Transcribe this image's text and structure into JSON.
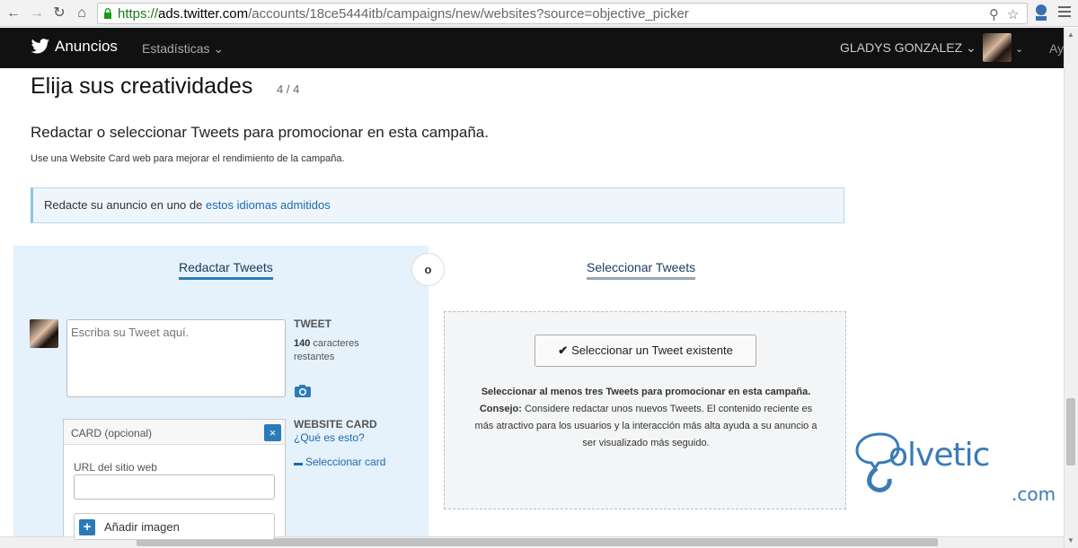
{
  "browser": {
    "url_scheme": "https://",
    "url_host": "ads.twitter.com",
    "url_path": "/accounts/18ce5444itb/campaigns/new/websites?source=objective_picker"
  },
  "nav": {
    "brand": "Anuncios",
    "stats": "Estadísticas",
    "user": "GLADYS GONZALEZ",
    "help": "Ay"
  },
  "page": {
    "title": "Elija sus creatividades",
    "step": "4 / 4",
    "subtitle": "Redactar o seleccionar Tweets para promocionar en esta campaña.",
    "hint": "Use una Website Card web para mejorar el rendimiento de la campaña.",
    "notice_text": "Redacte su anuncio en uno de ",
    "notice_link": "estos idiomas admitidos"
  },
  "tabs": {
    "compose": "Redactar Tweets",
    "or": "o",
    "select": "Seleccionar Tweets"
  },
  "compose": {
    "placeholder": "Escriba su Tweet aquí.",
    "tweet_label": "TWEET",
    "count_value": "140",
    "count_text": " caracteres restantes",
    "website_card_label": "WEBSITE CARD",
    "what_is_this": "¿Qué es esto?",
    "select_card": "Seleccionar card",
    "card_header": "CARD (opcional)",
    "card_close": "×",
    "url_label": "URL del sitio web",
    "add_image": "Añadir imagen"
  },
  "select": {
    "button": "Seleccionar un Tweet existente",
    "desc_bold": "Seleccionar al menos tres Tweets para promocionar en esta campaña.",
    "tip_label": "Consejo:",
    "tip_text": " Considere redactar unos nuevos Tweets. El contenido reciente es más atractivo para los usuarios y la interacción más alta ayuda a su anuncio a ser visualizado más seguido."
  },
  "watermark": {
    "text": "olvetic",
    "domain": ".com"
  },
  "colors": {
    "accent": "#2b7bb9",
    "link": "#1b6ab0",
    "navbar": "#111111",
    "panel": "#e5f1fb"
  }
}
